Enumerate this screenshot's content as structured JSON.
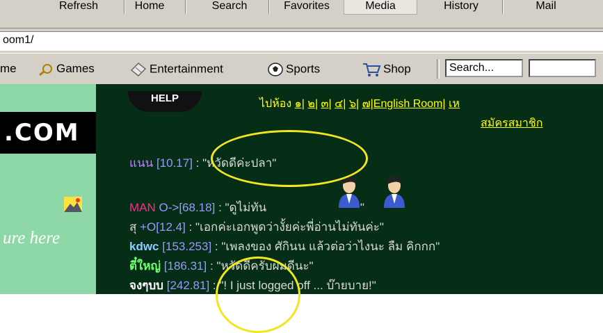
{
  "toolbar": {
    "refresh": "Refresh",
    "home": "Home",
    "search": "Search",
    "favorites": "Favorites",
    "media": "Media",
    "history": "History",
    "mail": "Mail"
  },
  "address": {
    "url": "oom1/"
  },
  "links": {
    "home": "me",
    "games": "Games",
    "entertainment": "Entertainment",
    "sports": "Sports",
    "shop": "Shop",
    "search_placeholder": "Search..."
  },
  "page": {
    "logo": ".COM",
    "ad_text": "ure here",
    "help": "HELP",
    "rooms_prefix": "ไปห้อง",
    "rooms": [
      "๑|",
      "๒|",
      "๓|",
      "๔|",
      "๖|",
      "๗|English Room|",
      "เห"
    ],
    "register": "สมัครสมาชิก"
  },
  "chat": [
    {
      "nick": "แนน",
      "nick_color": "#c080ff",
      "ip": "[10.17]",
      "text": ": \"หวัดดีค่ะปลา\"",
      "text_color": "#d8d8d8"
    },
    {
      "nick": "MAN",
      "nick_color": "#ff2a8a",
      "ip": "O->[68.18]",
      "text": ": \"ดูไม่ทัน",
      "tail": "\"",
      "text_color": "#d8d8d8"
    },
    {
      "nick": "สุ",
      "nick_color": "#d8d8d8",
      "ip": "+O[12.4]",
      "text": ": \"เอกค่ะเอกพูดว่างั้ยค่ะพี่อ่านไม่ทันค่ะ\"",
      "text_color": "#d8d8d8"
    },
    {
      "nick": "kdwc",
      "nick_color": "#8ecbff",
      "ip": "[153.253]",
      "text": ": \"เพลงของ ศักินน แล้วต่อว่าไงนะ ลืม คิกกก\"",
      "text_color": "#d8d8d8"
    },
    {
      "nick": "ตี๋ใหญ่",
      "nick_color": "#6fff6f",
      "ip": "[186.31]",
      "text": ": \"หวัดดีครับผมดีนะ\"",
      "text_color": "#d8d8d8"
    },
    {
      "nick": "จงๆบบ",
      "nick_color": "#ffffff",
      "ip": "[242.81]",
      "text": ": \"! I just logged off ... บ๊ายบาย!\"",
      "text_color": "#d8d8d8"
    }
  ],
  "colors": {
    "highlight": "#f2e621",
    "sidebar": "#8ed8a8",
    "chrome": "#d4d0c8"
  }
}
